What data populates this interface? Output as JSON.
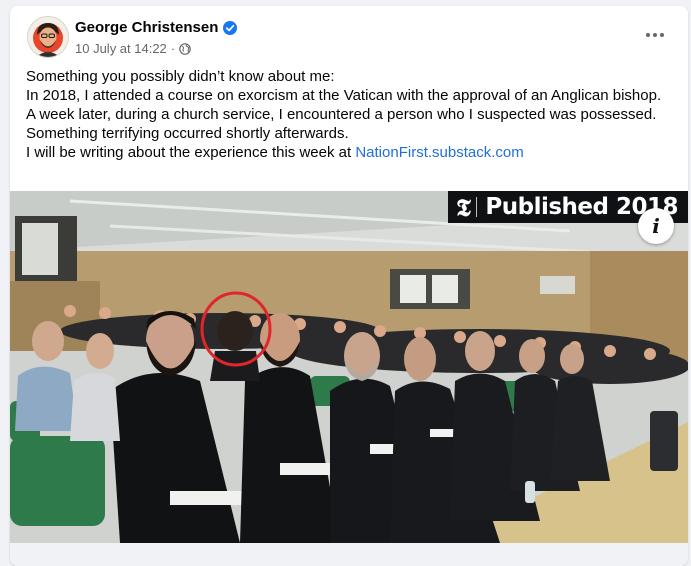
{
  "post": {
    "author_name": "George Christensen",
    "date": "10 July at 14:22",
    "separator": "·",
    "verified_icon": "verified-badge-icon",
    "privacy_icon": "globe-icon",
    "lines": [
      "Something you possibly didn’t know about me:",
      "In 2018, I attended a course on exorcism at the Vatican with the approval of an Anglican bishop.",
      "A week later, during a church service, I encountered a person who I suspected was possessed.",
      "Something terrifying occurred shortly afterwards."
    ],
    "last_line_prefix": "I will be writing about the experience this week at ",
    "link_text": "NationFirst.substack.com"
  },
  "photo": {
    "badge_logo": "𝕿",
    "badge_text": "Published 2018",
    "info_label": "i"
  },
  "colors": {
    "link": "#216fdb",
    "verified": "#1877f2",
    "meta": "#65676b",
    "highlight_circle": "#e0262b"
  }
}
